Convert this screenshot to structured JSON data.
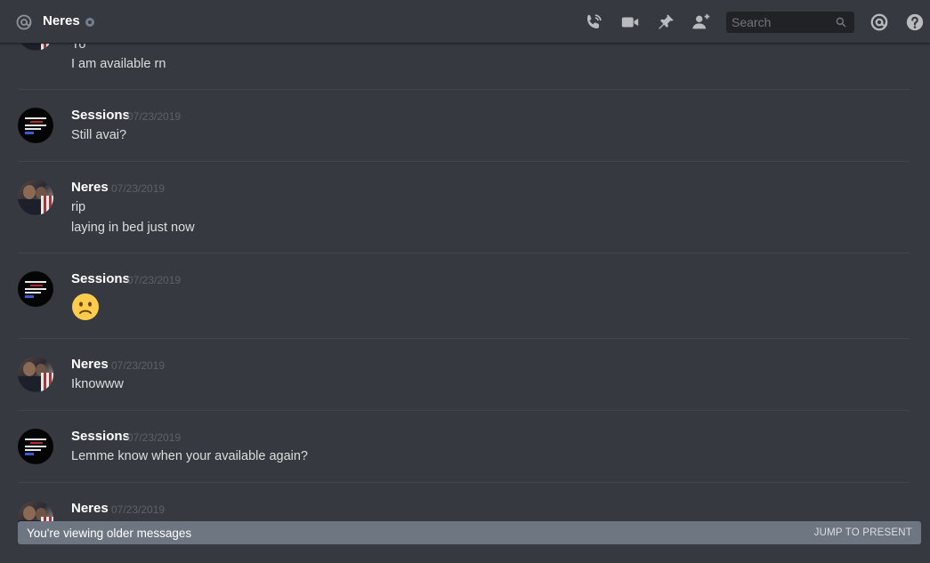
{
  "header": {
    "channel_icon": "at-icon",
    "channel_name": "Neres",
    "status_icon": "offline-status-dot",
    "actions": [
      "call-icon",
      "video-icon",
      "pin-icon",
      "add-friend-icon"
    ],
    "search_placeholder": "Search",
    "mention_icon": "at-icon",
    "help_icon": "help-icon"
  },
  "messages": [
    {
      "author": "",
      "timestamp": "",
      "partial_top": "Yo",
      "lines": [
        "I am available rn"
      ]
    },
    {
      "author": "Sessions",
      "timestamp": "07/23/2019",
      "lines": [
        "Still avai?"
      ]
    },
    {
      "author": "Neres",
      "timestamp": "07/23/2019",
      "lines": [
        "rip",
        "laying in bed just now"
      ]
    },
    {
      "author": "Sessions",
      "timestamp": "07/23/2019",
      "emoji": "frowning-face"
    },
    {
      "author": "Neres",
      "timestamp": "07/23/2019",
      "lines": [
        "Iknowww"
      ]
    },
    {
      "author": "Sessions",
      "timestamp": "07/23/2019",
      "lines": [
        "Lemme know when your available again?"
      ]
    },
    {
      "author": "Neres",
      "timestamp": "07/23/2019",
      "lines": []
    }
  ],
  "older_bar": {
    "text": "You're viewing older messages",
    "jump_label": "JUMP TO PRESENT"
  },
  "colors": {
    "background": "#36393f",
    "header_border": "#202225",
    "text": "#dcddde",
    "username": "#ffffff",
    "timestamp": "#5d6168",
    "older_bar": "#6e7681"
  }
}
